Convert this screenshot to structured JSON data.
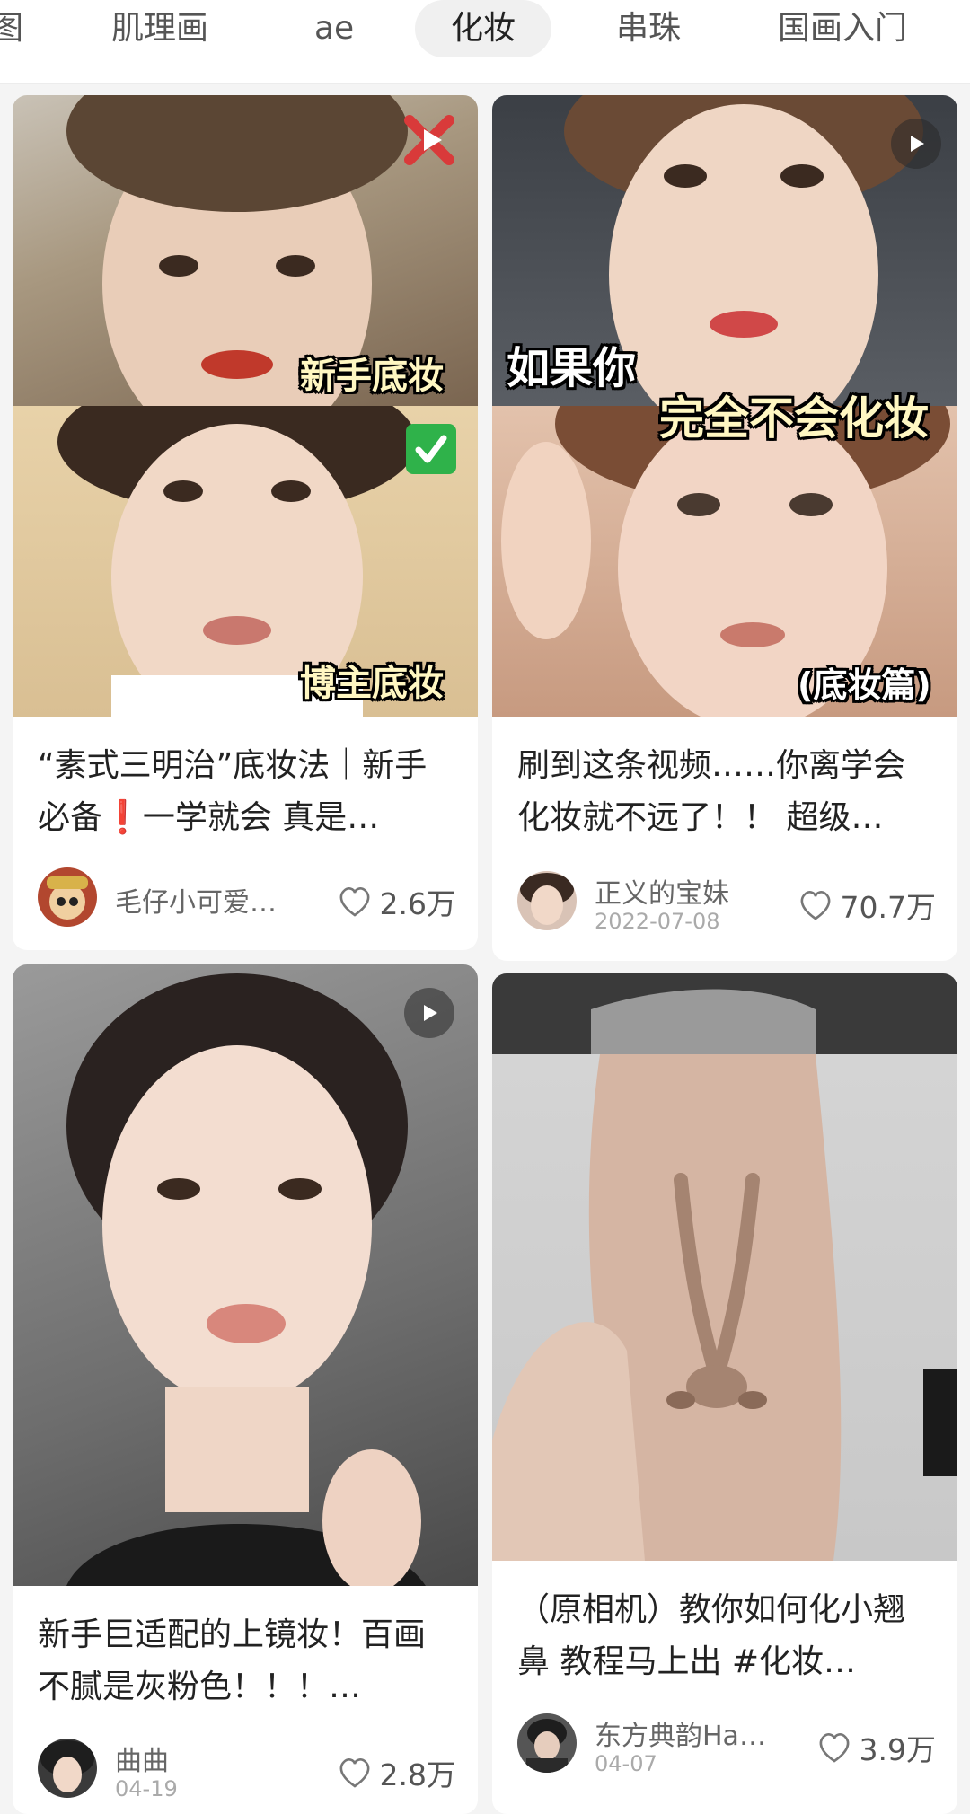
{
  "tabs": [
    {
      "label": "图"
    },
    {
      "label": "肌理画"
    },
    {
      "label": "ae"
    },
    {
      "label": "化妆",
      "active": true
    },
    {
      "label": "串珠"
    },
    {
      "label": "国画入门"
    }
  ],
  "cards": [
    {
      "cover_texts": [
        "新手底妆",
        "博主底妆"
      ],
      "title": "“素式三明治”底妆法｜新手必备❗️一学就会 真是…",
      "author": "毛仔小可爱…",
      "date": "",
      "likes": "2.6万",
      "icons": [
        "cross-mark-icon",
        "check-mark-icon",
        "play-icon"
      ]
    },
    {
      "cover_texts": [
        "如果你",
        "完全不会化妆",
        "(底妆篇)"
      ],
      "title": "刷到这条视频……你离学会化妆就不远了！！ 超级…",
      "author": "正义的宝妹",
      "date": "2022-07-08",
      "likes": "70.7万",
      "icons": [
        "play-icon"
      ]
    },
    {
      "cover_texts": [],
      "title": "新手巨适配的上镜妆！百画不腻是灰粉色！！！…",
      "author": "曲曲",
      "date": "04-19",
      "likes": "2.8万",
      "icons": [
        "play-icon"
      ]
    },
    {
      "cover_texts": [],
      "title": "（原相机）教你如何化小翘鼻 教程马上出 #化妆…",
      "author": "东方典韵Ha…",
      "date": "04-07",
      "likes": "3.9万",
      "icons": []
    }
  ],
  "colors": {
    "page_bg": "#f4f4f4",
    "card_bg": "#ffffff",
    "tab_active_bg": "#f0f0f0",
    "cover_caption": "#fff7c2"
  }
}
